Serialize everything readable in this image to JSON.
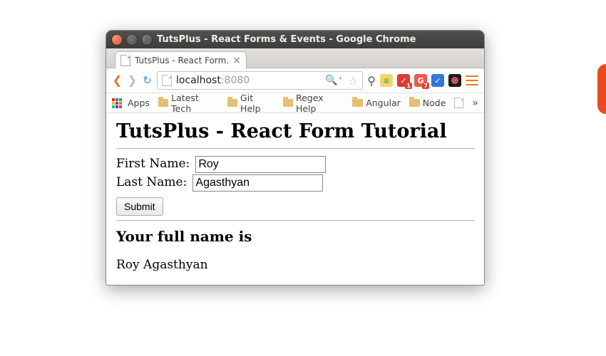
{
  "window": {
    "title": "TutsPlus - React Forms & Events - Google Chrome"
  },
  "tab": {
    "title": "TutsPlus - React Form…"
  },
  "url": {
    "host": "localhost",
    "port": ":8080"
  },
  "extensions": [
    {
      "badge": "1"
    },
    {
      "badge": "7"
    }
  ],
  "bookmarks": {
    "apps": "Apps",
    "items": [
      "Latest Tech",
      "Git Help",
      "Regex Help",
      "Angular",
      "Node"
    ]
  },
  "page": {
    "heading": "TutsPlus - React Form Tutorial",
    "fn_label": "First Name:",
    "fn_value": "Roy",
    "ln_label": "Last Name:",
    "ln_value": "Agasthyan",
    "submit_label": "Submit",
    "result_heading": "Your full name is",
    "result_value": "Roy Agasthyan"
  }
}
